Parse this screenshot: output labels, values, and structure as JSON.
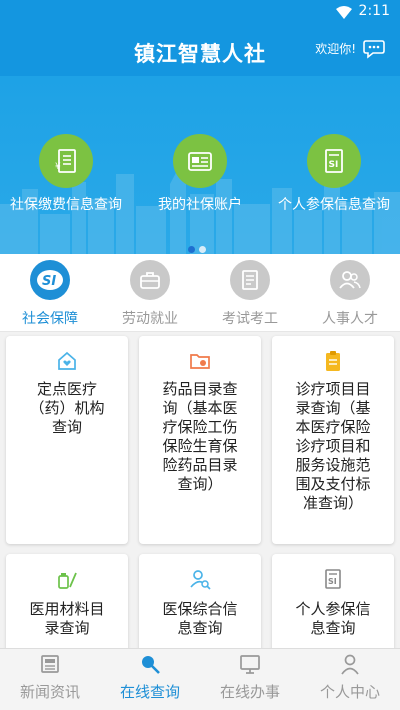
{
  "status_bar": {
    "time": "2:11"
  },
  "header": {
    "title": "镇江智慧人社",
    "welcome": "欢迎你!"
  },
  "banner": {
    "features": [
      {
        "label": "社保缴费信息查询",
        "icon": "receipt-yen-icon"
      },
      {
        "label": "我的社保账户",
        "icon": "account-card-icon"
      },
      {
        "label": "个人参保信息查询",
        "icon": "si-document-icon"
      }
    ],
    "active_slide": 1,
    "slide_count": 2
  },
  "categories": [
    {
      "label": "社会保障",
      "active": true,
      "icon": "social-security-icon"
    },
    {
      "label": "劳动就业",
      "active": false,
      "icon": "briefcase-icon"
    },
    {
      "label": "考试考工",
      "active": false,
      "icon": "exam-certificate-icon"
    },
    {
      "label": "人事人才",
      "active": false,
      "icon": "people-icon"
    }
  ],
  "services": [
    {
      "label": "定点医疗（药）机构查询",
      "icon": "pharmacy-house-icon"
    },
    {
      "label": "药品目录查询（基本医疗保险工伤保险生育保险药品目录查询）",
      "icon": "medicine-folder-icon"
    },
    {
      "label": "诊疗项目目录查询（基本医疗保险诊疗项目和服务设施范围及支付标准查询）",
      "icon": "clipboard-icon"
    },
    {
      "label": "医用材料目录查询",
      "icon": "medical-supplies-icon"
    },
    {
      "label": "医保综合信息查询",
      "icon": "person-search-icon"
    },
    {
      "label": "个人参保信息查询",
      "icon": "si-document-icon"
    }
  ],
  "bottom_nav": [
    {
      "label": "新闻资讯",
      "active": false,
      "icon": "news-icon"
    },
    {
      "label": "在线查询",
      "active": true,
      "icon": "search-icon"
    },
    {
      "label": "在线办事",
      "active": false,
      "icon": "monitor-icon"
    },
    {
      "label": "个人中心",
      "active": false,
      "icon": "user-icon"
    }
  ],
  "colors": {
    "primary": "#1496e0",
    "accent": "#1e8fd6",
    "feature_green": "#7cc242",
    "inactive": "#999999"
  }
}
